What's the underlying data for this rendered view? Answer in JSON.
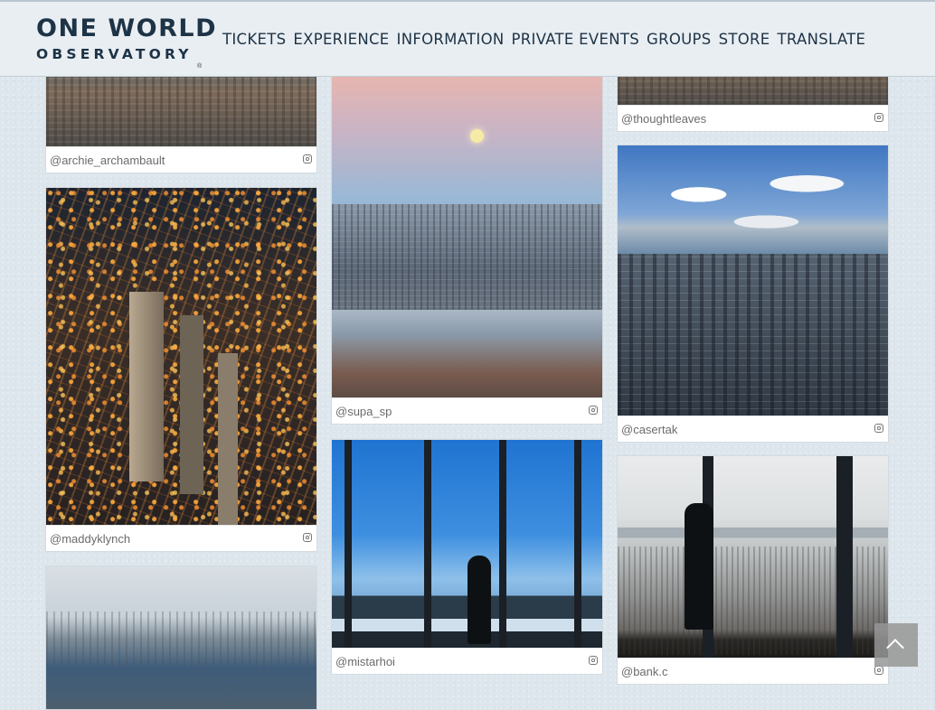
{
  "logo": {
    "line1": "ONE WORLD",
    "line2": "OBSERVATORY",
    "tm": "®"
  },
  "nav": {
    "items": [
      "TICKETS",
      "EXPERIENCE",
      "INFORMATION",
      "PRIVATE EVENTS",
      "GROUPS",
      "STORE",
      "TRANSLATE"
    ]
  },
  "gallery": {
    "posts": [
      {
        "handle": "@archie_archambault",
        "icon": "instagram-icon"
      },
      {
        "handle": "@maddyklynch",
        "icon": "instagram-icon"
      },
      {
        "handle": "",
        "icon": "instagram-icon"
      },
      {
        "handle": "@supa_sp",
        "icon": "instagram-icon"
      },
      {
        "handle": "@mistarhoi",
        "icon": "instagram-icon"
      },
      {
        "handle": "@thoughtleaves",
        "icon": "instagram-icon"
      },
      {
        "handle": "@casertak",
        "icon": "instagram-icon"
      },
      {
        "handle": "@bank.c",
        "icon": "instagram-icon"
      }
    ]
  },
  "scroll_top": {
    "icon": "chevron-up-icon"
  },
  "colors": {
    "brand": "#1d3346",
    "background": "#dde6ec",
    "card": "#ffffff",
    "handle_text": "#6b6b6b"
  }
}
